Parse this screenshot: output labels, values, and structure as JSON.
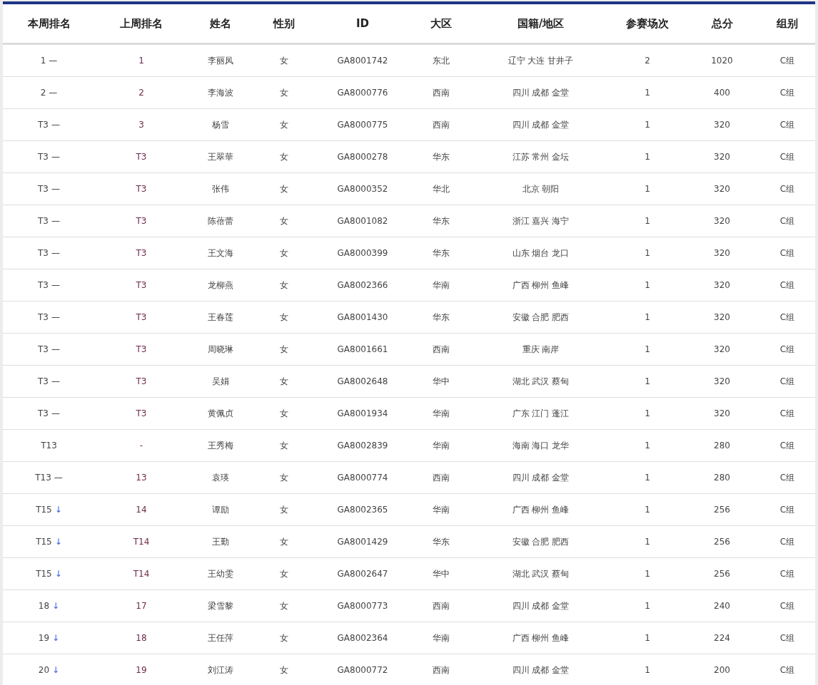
{
  "columns": [
    "本周排名",
    "上周排名",
    "姓名",
    "性别",
    "ID",
    "大区",
    "国籍/地区",
    "参赛场次",
    "总分",
    "组别"
  ],
  "rows": [
    {
      "rank": "1",
      "trend": "—",
      "kind": "same",
      "prev": "1",
      "name": "李丽凤",
      "gender": "女",
      "id": "GA8001742",
      "region": "东北",
      "location": "辽宁 大连 甘井子",
      "events": "2",
      "score": "1020",
      "group": "C组"
    },
    {
      "rank": "2",
      "trend": "—",
      "kind": "same",
      "prev": "2",
      "name": "李海波",
      "gender": "女",
      "id": "GA8000776",
      "region": "西南",
      "location": "四川 成都 金堂",
      "events": "1",
      "score": "400",
      "group": "C组"
    },
    {
      "rank": "T3",
      "trend": "—",
      "kind": "same",
      "prev": "3",
      "name": "杨雪",
      "gender": "女",
      "id": "GA8000775",
      "region": "西南",
      "location": "四川 成都 金堂",
      "events": "1",
      "score": "320",
      "group": "C组"
    },
    {
      "rank": "T3",
      "trend": "—",
      "kind": "same",
      "prev": "T3",
      "name": "王翠華",
      "gender": "女",
      "id": "GA8000278",
      "region": "华东",
      "location": "江苏 常州 金坛",
      "events": "1",
      "score": "320",
      "group": "C组"
    },
    {
      "rank": "T3",
      "trend": "—",
      "kind": "same",
      "prev": "T3",
      "name": "张伟",
      "gender": "女",
      "id": "GA8000352",
      "region": "华北",
      "location": "北京 朝阳",
      "events": "1",
      "score": "320",
      "group": "C组"
    },
    {
      "rank": "T3",
      "trend": "—",
      "kind": "same",
      "prev": "T3",
      "name": "陈蓓蕾",
      "gender": "女",
      "id": "GA8001082",
      "region": "华东",
      "location": "浙江 嘉兴 海宁",
      "events": "1",
      "score": "320",
      "group": "C组"
    },
    {
      "rank": "T3",
      "trend": "—",
      "kind": "same",
      "prev": "T3",
      "name": "王文海",
      "gender": "女",
      "id": "GA8000399",
      "region": "华东",
      "location": "山东 烟台 龙口",
      "events": "1",
      "score": "320",
      "group": "C组"
    },
    {
      "rank": "T3",
      "trend": "—",
      "kind": "same",
      "prev": "T3",
      "name": "龙柳燕",
      "gender": "女",
      "id": "GA8002366",
      "region": "华南",
      "location": "广西 柳州 鱼峰",
      "events": "1",
      "score": "320",
      "group": "C组"
    },
    {
      "rank": "T3",
      "trend": "—",
      "kind": "same",
      "prev": "T3",
      "name": "王春莲",
      "gender": "女",
      "id": "GA8001430",
      "region": "华东",
      "location": "安徽 合肥 肥西",
      "events": "1",
      "score": "320",
      "group": "C组"
    },
    {
      "rank": "T3",
      "trend": "—",
      "kind": "same",
      "prev": "T3",
      "name": "周晓琳",
      "gender": "女",
      "id": "GA8001661",
      "region": "西南",
      "location": "重庆 南岸",
      "events": "1",
      "score": "320",
      "group": "C组"
    },
    {
      "rank": "T3",
      "trend": "—",
      "kind": "same",
      "prev": "T3",
      "name": "吴娟",
      "gender": "女",
      "id": "GA8002648",
      "region": "华中",
      "location": "湖北 武汉 蔡甸",
      "events": "1",
      "score": "320",
      "group": "C组"
    },
    {
      "rank": "T3",
      "trend": "—",
      "kind": "same",
      "prev": "T3",
      "name": "黄佩贞",
      "gender": "女",
      "id": "GA8001934",
      "region": "华南",
      "location": "广东 江门 蓬江",
      "events": "1",
      "score": "320",
      "group": "C组"
    },
    {
      "rank": "T13",
      "prev": "-",
      "name": "王秀梅",
      "gender": "女",
      "id": "GA8002839",
      "region": "华南",
      "location": "海南 海口 龙华",
      "events": "1",
      "score": "280",
      "group": "C组"
    },
    {
      "rank": "T13",
      "trend": "—",
      "kind": "same",
      "prev": "13",
      "name": "袁瑛",
      "gender": "女",
      "id": "GA8000774",
      "region": "西南",
      "location": "四川 成都 金堂",
      "events": "1",
      "score": "280",
      "group": "C组"
    },
    {
      "rank": "T15",
      "trend": "↓",
      "kind": "down",
      "prev": "14",
      "name": "谭励",
      "gender": "女",
      "id": "GA8002365",
      "region": "华南",
      "location": "广西 柳州 鱼峰",
      "events": "1",
      "score": "256",
      "group": "C组"
    },
    {
      "rank": "T15",
      "trend": "↓",
      "kind": "down",
      "prev": "T14",
      "name": "王勤",
      "gender": "女",
      "id": "GA8001429",
      "region": "华东",
      "location": "安徽 合肥 肥西",
      "events": "1",
      "score": "256",
      "group": "C组"
    },
    {
      "rank": "T15",
      "trend": "↓",
      "kind": "down",
      "prev": "T14",
      "name": "王幼雯",
      "gender": "女",
      "id": "GA8002647",
      "region": "华中",
      "location": "湖北 武汉 蔡甸",
      "events": "1",
      "score": "256",
      "group": "C组"
    },
    {
      "rank": "18",
      "trend": "↓",
      "kind": "down",
      "prev": "17",
      "name": "梁雪黎",
      "gender": "女",
      "id": "GA8000773",
      "region": "西南",
      "location": "四川 成都 金堂",
      "events": "1",
      "score": "240",
      "group": "C组"
    },
    {
      "rank": "19",
      "trend": "↓",
      "kind": "down",
      "prev": "18",
      "name": "王任萍",
      "gender": "女",
      "id": "GA8002364",
      "region": "华南",
      "location": "广西 柳州 鱼峰",
      "events": "1",
      "score": "224",
      "group": "C组"
    },
    {
      "rank": "20",
      "trend": "↓",
      "kind": "down",
      "prev": "19",
      "name": "刘江涛",
      "gender": "女",
      "id": "GA8000772",
      "region": "西南",
      "location": "四川 成都 金堂",
      "events": "1",
      "score": "200",
      "group": "C组"
    }
  ]
}
